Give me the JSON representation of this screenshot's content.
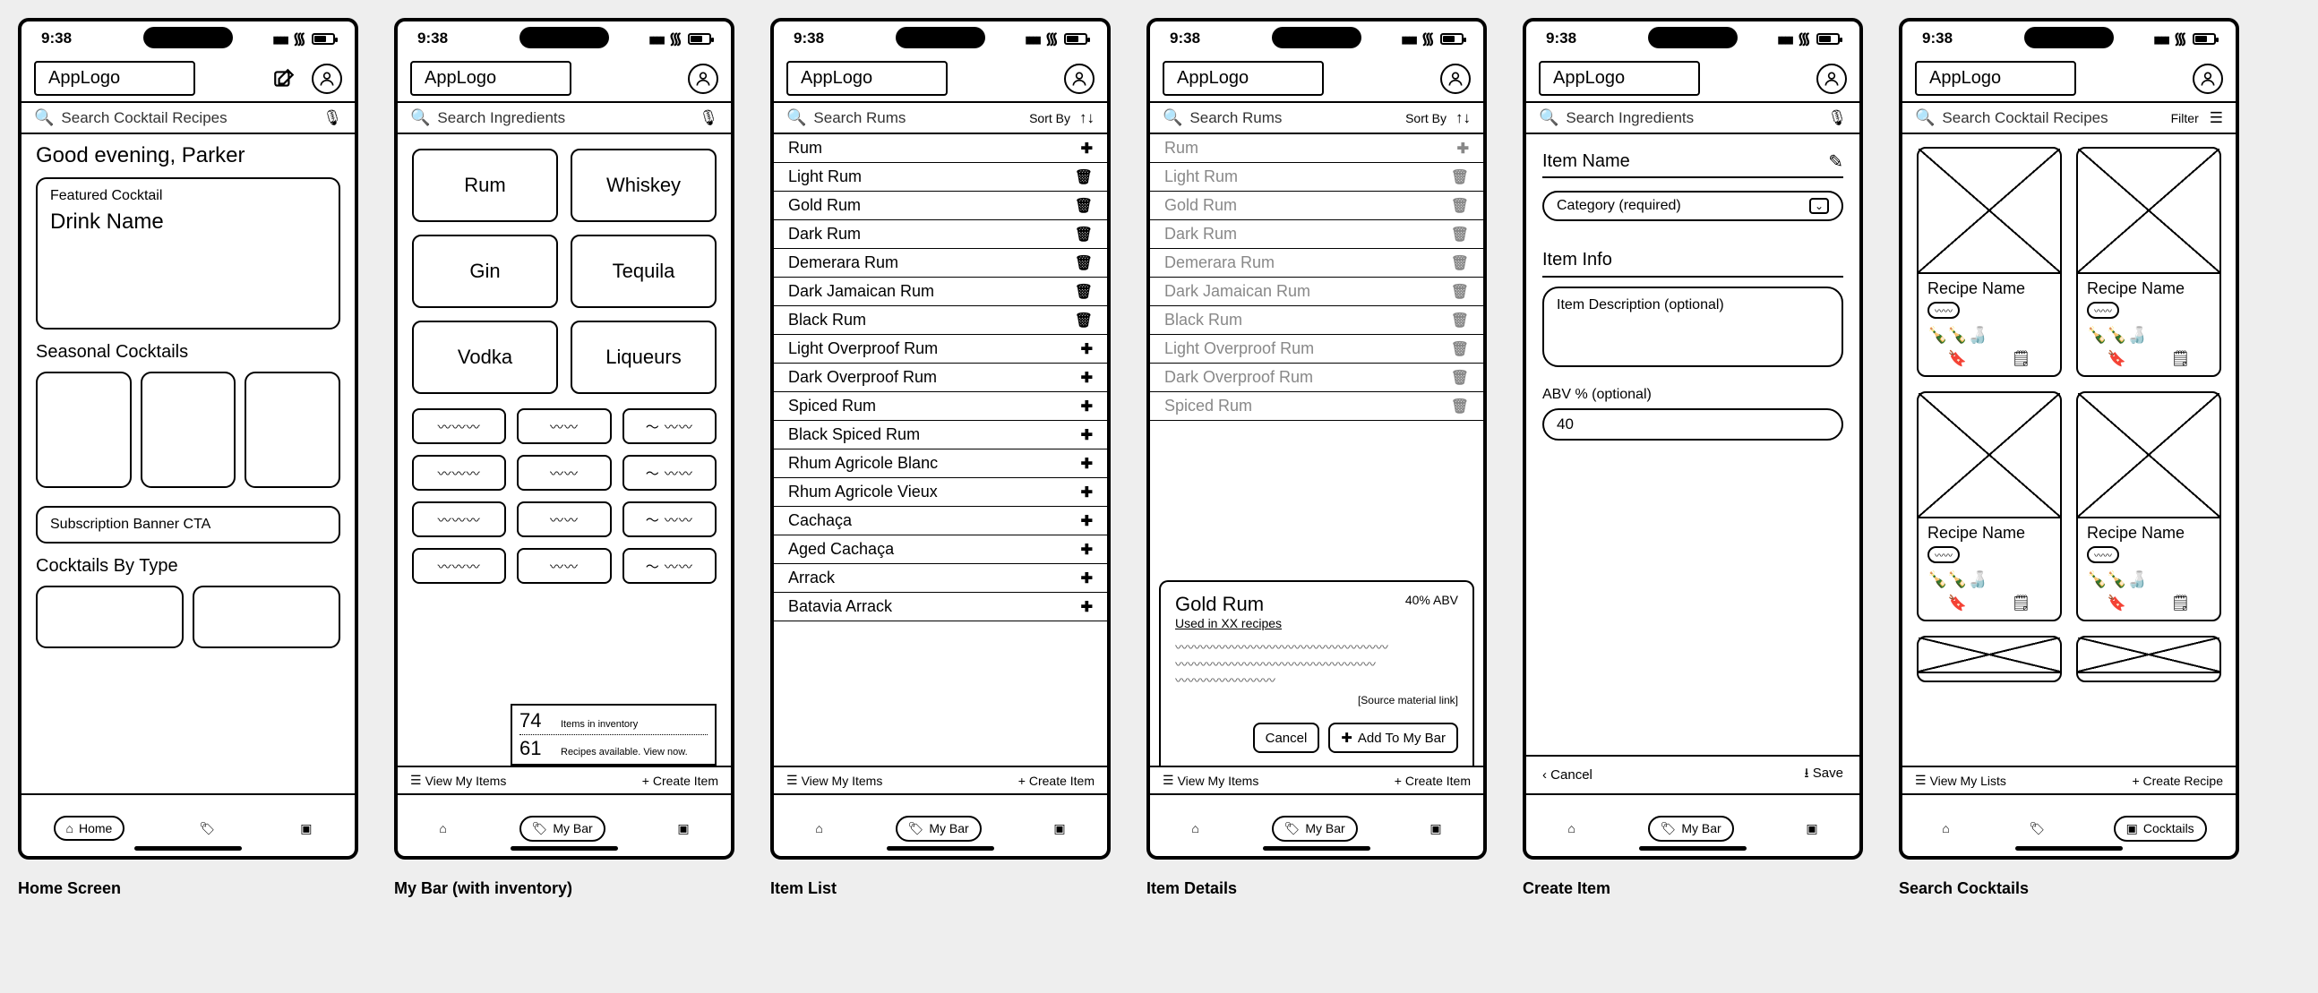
{
  "status": {
    "time": "9:38"
  },
  "app": {
    "logo": "AppLogo"
  },
  "screens": {
    "home": {
      "label": "Home Screen",
      "search_placeholder": "Search Cocktail Recipes",
      "greeting": "Good evening, Parker",
      "featured_label": "Featured Cocktail",
      "featured_drink": "Drink Name",
      "seasonal_label": "Seasonal Cocktails",
      "sub_cta": "Subscription Banner CTA",
      "bytype_label": "Cocktails By Type",
      "tab_home": "Home"
    },
    "mybar": {
      "label": "My Bar (with inventory)",
      "search_placeholder": "Search Ingredients",
      "categories": [
        "Rum",
        "Whiskey",
        "Gin",
        "Tequila",
        "Vodka",
        "Liqueurs"
      ],
      "stats": {
        "inv_count": "74",
        "inv_label": "Items in inventory",
        "rec_count": "61",
        "rec_label": "Recipes available. View now."
      },
      "view_items": "View My Items",
      "create_item": "+ Create Item",
      "tab_mybar": "My Bar"
    },
    "itemlist": {
      "label": "Item List",
      "search_placeholder": "Search Rums",
      "sortby": "Sort By",
      "items": [
        {
          "name": "Rum",
          "action": "plus"
        },
        {
          "name": "Light Rum",
          "action": "trash"
        },
        {
          "name": "Gold Rum",
          "action": "trash"
        },
        {
          "name": "Dark Rum",
          "action": "trash"
        },
        {
          "name": "Demerara Rum",
          "action": "trash"
        },
        {
          "name": "Dark Jamaican Rum",
          "action": "trash"
        },
        {
          "name": "Black Rum",
          "action": "trash"
        },
        {
          "name": "Light Overproof Rum",
          "action": "plus"
        },
        {
          "name": "Dark Overproof Rum",
          "action": "plus"
        },
        {
          "name": "Spiced Rum",
          "action": "plus"
        },
        {
          "name": "Black Spiced Rum",
          "action": "plus"
        },
        {
          "name": "Rhum Agricole Blanc",
          "action": "plus"
        },
        {
          "name": "Rhum Agricole Vieux",
          "action": "plus"
        },
        {
          "name": "Cachaça",
          "action": "plus"
        },
        {
          "name": "Aged Cachaça",
          "action": "plus"
        },
        {
          "name": "Arrack",
          "action": "plus"
        },
        {
          "name": "Batavia Arrack",
          "action": "plus"
        }
      ],
      "view_items": "View My Items",
      "create_item": "+ Create Item"
    },
    "itemdetails": {
      "label": "Item Details",
      "search_placeholder": "Search Rums",
      "sortby": "Sort By",
      "dimmed": [
        "Rum",
        "Light Rum",
        "Gold Rum",
        "Dark Rum",
        "Demerara Rum",
        "Dark Jamaican Rum",
        "Black Rum",
        "Light Overproof Rum",
        "Dark Overproof Rum",
        "Spiced Rum"
      ],
      "sheet": {
        "title": "Gold Rum",
        "abv": "40% ABV",
        "usedin": "Used in XX recipes",
        "source": "[Source material link]",
        "cancel": "Cancel",
        "add": "Add To My Bar"
      },
      "view_items": "View My Items",
      "create_item": "+ Create Item"
    },
    "createitem": {
      "label": "Create Item",
      "search_placeholder": "Search Ingredients",
      "name_field": "Item Name",
      "category_placeholder": "Category (required)",
      "info_section": "Item Info",
      "desc_placeholder": "Item Description (optional)",
      "abv_label": "ABV % (optional)",
      "abv_value": "40",
      "cancel": "Cancel",
      "save": "Save"
    },
    "searchcocktails": {
      "label": "Search Cocktails",
      "search_placeholder": "Search Cocktail Recipes",
      "filter_label": "Filter",
      "recipe_name": "Recipe Name",
      "view_lists": "View My Lists",
      "create_recipe": "+ Create Recipe",
      "tab_cocktails": "Cocktails"
    }
  }
}
